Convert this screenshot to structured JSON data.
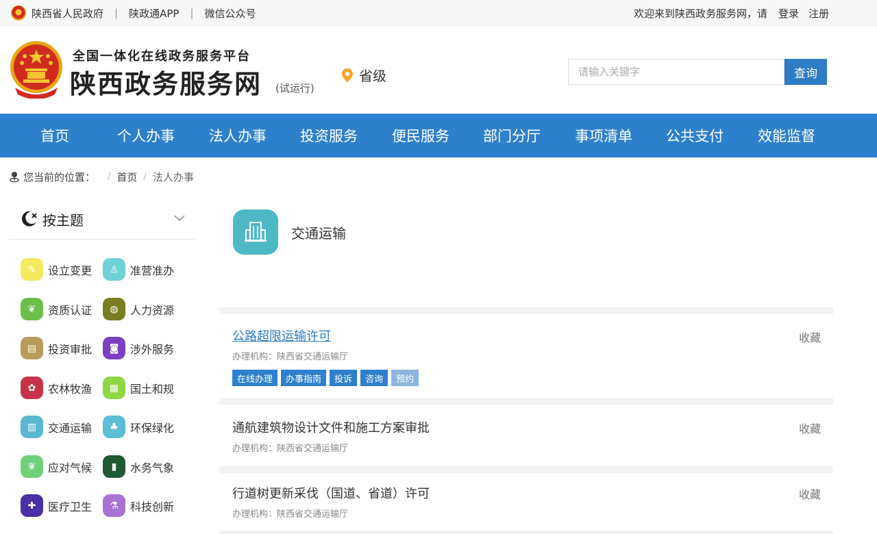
{
  "topbar": {
    "links": [
      "陕西省人民政府",
      "陕政通APP",
      "微信公众号"
    ],
    "separator": "|",
    "welcome": "欢迎来到陕西政务服务网，请",
    "login": "登录",
    "register": "注册"
  },
  "header": {
    "subtitle": "全国一体化在线政务服务平台",
    "title": "陕西政务服务网",
    "trial": "(试运行)",
    "location": "省级",
    "search_placeholder": "请输入关键字",
    "search_button": "查询"
  },
  "nav": [
    "首页",
    "个人办事",
    "法人办事",
    "投资服务",
    "便民服务",
    "部门分厅",
    "事项清单",
    "公共支付",
    "效能监督"
  ],
  "breadcrumb": {
    "label": "您当前的位置：",
    "sep": "/",
    "items": [
      "首页",
      "法人办事"
    ]
  },
  "sidebar": {
    "title": "按主题",
    "categories": [
      {
        "label": "设立变更",
        "color": "#f2ea5f",
        "icon": "pencil-icon"
      },
      {
        "label": "准营准办",
        "color": "#6ed2d8",
        "icon": "stamp-icon"
      },
      {
        "label": "资质认证",
        "color": "#6cc04a",
        "icon": "leaf-icon"
      },
      {
        "label": "人力资源",
        "color": "#7a7d21",
        "icon": "globe-icon"
      },
      {
        "label": "投资审批",
        "color": "#b89b59",
        "icon": "clipboard-icon"
      },
      {
        "label": "涉外服务",
        "color": "#7b3fc3",
        "icon": "camera-icon"
      },
      {
        "label": "农林牧渔",
        "color": "#c7344a",
        "icon": "pig-icon"
      },
      {
        "label": "国土和规",
        "color": "#8fd646",
        "icon": "map-icon"
      },
      {
        "label": "交通运输",
        "color": "#5bb8cf",
        "icon": "building-icon"
      },
      {
        "label": "环保绿化",
        "color": "#5bbed4",
        "icon": "tree-icon"
      },
      {
        "label": "应对气候",
        "color": "#6fd07a",
        "icon": "leaf-icon"
      },
      {
        "label": "水务气象",
        "color": "#1f5a35",
        "icon": "thermometer-icon"
      },
      {
        "label": "医疗卫生",
        "color": "#4a2fa8",
        "icon": "medical-icon"
      },
      {
        "label": "科技创新",
        "color": "#a774d1",
        "icon": "lab-icon"
      }
    ]
  },
  "content": {
    "topic": "交通运输",
    "org_label": "办理机构：",
    "entries": [
      {
        "title": "公路超限运输许可",
        "org": "陕西省交通运输厅",
        "fav": "收藏",
        "tags": [
          "在线办理",
          "办事指南",
          "投诉",
          "咨询",
          "预约"
        ]
      },
      {
        "title": "通航建筑物设计文件和施工方案审批",
        "org": "陕西省交通运输厅",
        "fav": "收藏",
        "tags": []
      },
      {
        "title": "行道树更新采伐（国道、省道）许可",
        "org": "陕西省交通运输厅",
        "fav": "收藏",
        "tags": []
      }
    ]
  },
  "colors": {
    "primary": "#2f80cc",
    "topic_icon": "#4fb8c7",
    "tag_disabled": "#8bb5df"
  }
}
